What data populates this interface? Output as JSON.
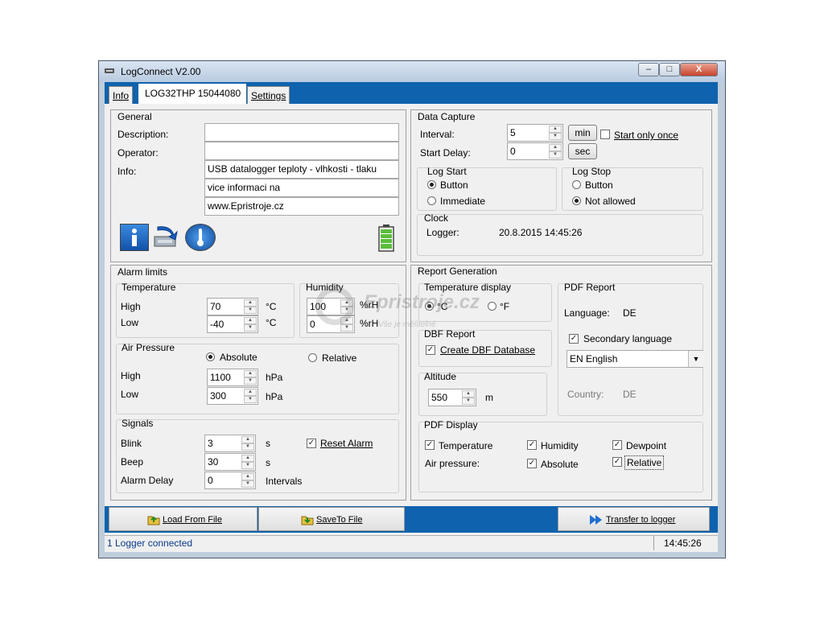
{
  "window": {
    "title": "LogConnect V2.00",
    "min": "–",
    "max": "□",
    "close": "X"
  },
  "tabs": [
    "Info",
    "LOG32THP 15044080",
    "Settings"
  ],
  "general": {
    "title": "General",
    "description_label": "Description:",
    "description": "",
    "operator_label": "Operator:",
    "operator": "",
    "info_label": "Info:",
    "info_lines": [
      "USB datalogger teploty - vlhkosti - tlaku",
      "vice informaci na",
      "www.Epristroje.cz"
    ]
  },
  "data_capture": {
    "title": "Data Capture",
    "interval_label": "Interval:",
    "interval": "5",
    "interval_unit": "min",
    "start_only_once": "Start only once",
    "start_delay_label": "Start Delay:",
    "start_delay": "0",
    "start_delay_unit": "sec",
    "log_start": {
      "title": "Log Start",
      "options": [
        "Button",
        "Immediate"
      ],
      "selected": "Button"
    },
    "log_stop": {
      "title": "Log Stop",
      "options": [
        "Button",
        "Not allowed"
      ],
      "selected": "Not allowed"
    },
    "clock": {
      "title": "Clock",
      "logger_label": "Logger:",
      "logger_time": "20.8.2015 14:45:26"
    }
  },
  "alarm_limits": {
    "title": "Alarm limits",
    "temperature": {
      "title": "Temperature",
      "high_label": "High",
      "high": "70",
      "low_label": "Low",
      "low": "-40",
      "unit": "°C"
    },
    "humidity": {
      "title": "Humidity",
      "high": "100",
      "low": "0",
      "unit": "%rH"
    },
    "air_pressure": {
      "title": "Air Pressure",
      "absolute": "Absolute",
      "relative": "Relative",
      "selected": "Absolute",
      "high_label": "High",
      "high": "1100",
      "low_label": "Low",
      "low": "300",
      "unit": "hPa"
    },
    "signals": {
      "title": "Signals",
      "blink_label": "Blink",
      "blink": "3",
      "blink_unit": "s",
      "beep_label": "Beep",
      "beep": "30",
      "beep_unit": "s",
      "alarm_delay_label": "Alarm Delay",
      "alarm_delay": "0",
      "alarm_delay_unit": "Intervals",
      "reset_alarm": "Reset Alarm"
    }
  },
  "report": {
    "title": "Report Generation",
    "temp_display": {
      "title": "Temperature display",
      "c": "°C",
      "f": "°F",
      "selected": "°C"
    },
    "dbf": {
      "title": "DBF Report",
      "create": "Create DBF Database"
    },
    "altitude": {
      "title": "Altitude",
      "value": "550",
      "unit": "m"
    },
    "pdf_report": {
      "title": "PDF Report",
      "language_label": "Language:",
      "language": "DE",
      "secondary": "Secondary language",
      "secondary_value": "EN  English",
      "country_label": "Country:",
      "country": "DE"
    },
    "pdf_display": {
      "title": "PDF Display",
      "temperature": "Temperature",
      "humidity": "Humidity",
      "dewpoint": "Dewpoint",
      "air_pressure_label": "Air pressure:",
      "absolute": "Absolute",
      "relative": "Relative"
    }
  },
  "buttons": {
    "load": "Load From File",
    "save": "SaveTo File",
    "transfer": "Transfer to logger"
  },
  "status": {
    "text": "1 Logger connected",
    "time": "14:45:26"
  },
  "watermark": {
    "brand": "Epristroje.cz",
    "tagline": "Vše je měřitelné"
  },
  "colors": {
    "accent_blue": "#0f62ad",
    "titlebar": "#c8d6e8"
  }
}
